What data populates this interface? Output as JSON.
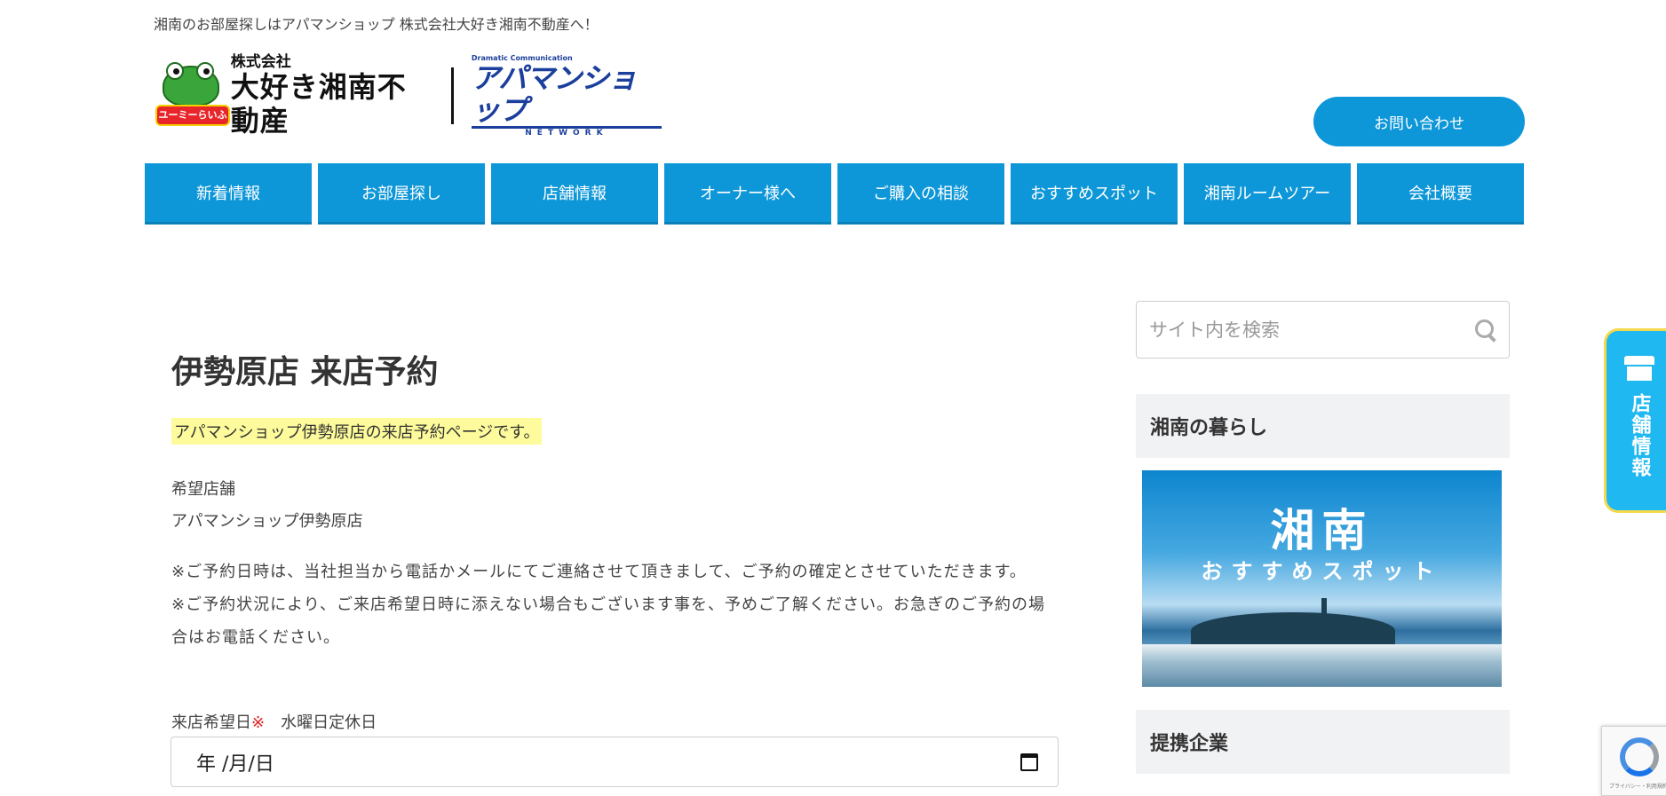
{
  "header": {
    "tagline": "湘南のお部屋探しはアパマンショップ 株式会社大好き湘南不動産へ！",
    "logo": {
      "mascot_label": "ユーミーらいふ",
      "company_small": "株式会社",
      "company_name": "大好き湘南不動産",
      "partner_tagline": "Dramatic Communication",
      "partner_name": "アパマンショップ",
      "partner_network": "NETWORK"
    },
    "contact_label": "お問い合わせ"
  },
  "nav": {
    "items": [
      {
        "label": "新着情報"
      },
      {
        "label": "お部屋探し"
      },
      {
        "label": "店舗情報"
      },
      {
        "label": "オーナー様へ"
      },
      {
        "label": "ご購入の相談"
      },
      {
        "label": "おすすめスポット"
      },
      {
        "label": "湘南ルームツアー"
      },
      {
        "label": "会社概要"
      }
    ]
  },
  "main": {
    "title": "伊勢原店 来店予約",
    "intro": "アパマンショップ伊勢原店の来店予約ページです。",
    "store_label": "希望店舗",
    "store_value": "アパマンショップ伊勢原店",
    "notice_1": "※ご予約日時は、当社担当から電話かメールにてご連絡させて頂きまして、ご予約の確定とさせていただきます。",
    "notice_2": "※ご予約状況により、ご来店希望日時に添えない場合もございます事を、予めご了解ください。お急ぎのご予約の場合はお電話ください。",
    "date_label": "来店希望日",
    "required_mark": "※",
    "closed_note": "水曜日定休日",
    "date_value": "年 /月/日"
  },
  "sidebar": {
    "search_placeholder": "サイト内を検索",
    "heading_life": "湘南の暮らし",
    "banner_title": "湘南",
    "banner_subtitle": "おすすめスポット",
    "heading_partners": "提携企業"
  },
  "floating_tab": {
    "label": "店舗情報"
  },
  "recaptcha": {
    "terms": "プライバシー・利用規約"
  },
  "colors": {
    "nav_blue": "#0e97d8",
    "highlight": "#fdfb9b",
    "required_red": "#e02020",
    "tab_blue": "#1fb8f0",
    "tab_border": "#f3d94b"
  }
}
